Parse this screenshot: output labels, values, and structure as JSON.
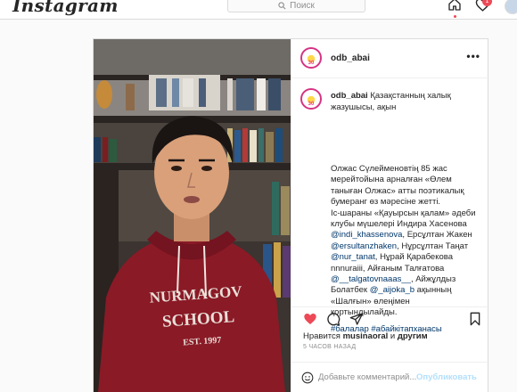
{
  "nav": {
    "logo": "Instagram",
    "search_placeholder": "Поиск",
    "notification_count": "1",
    "icons": [
      "home-icon",
      "activity-heart-icon",
      "profile-avatar"
    ]
  },
  "post": {
    "username": "odb_abai",
    "caption_title": "Қазақстанның халық жазушысы, ақын",
    "caption_lines": [
      "Олжас Сүлейменовтің 85 жас",
      "мерейтойына арналған «Өлем",
      "таныған Олжас» атты поэтикалық",
      "бумеранг өз мәресіне жетті.",
      "Іс-шараны «Қауырсын қалам» әдеби",
      "клубы мүшелері Индира Хасенова"
    ],
    "mention_1": "@indi_khassenova",
    "text_1": ", Ерсұлтан Жакен",
    "mention_2": "@ersultanzhaken",
    "text_2": ", Нұрсұлтан Таңат",
    "mention_3": "@nur_tanat",
    "text_3": ", Нұрай Қарабекова",
    "text_4": "nnnuraiii, Айғаным Талғатова",
    "mention_4": "@__talgatovnaaas__",
    "text_5": ", Айжұлдыз",
    "text_6": "Болатбек ",
    "mention_5": "@_aijoka_b",
    "text_7": " ақынның",
    "text_8": "«Шалғын» өлеңімен",
    "text_9": "қортындылайды.",
    "hashtags": "#балалар #абайкітапханасы",
    "likes_prefix": "Нравится ",
    "likes_user": "musinaoral",
    "likes_mid": " и ",
    "likes_others": "другим",
    "time_ago": "5 ЧАСОВ НАЗАД",
    "comment_placeholder": "Добавьте комментарий...",
    "publish_label": "Опубликовать",
    "liked": true,
    "colors": {
      "like": "#ed4956",
      "link": "#00376b",
      "publish_disabled": "#b2dffc"
    }
  },
  "video": {
    "hoodie_text_1": "NURMAGOV",
    "hoodie_text_2": "SCHOOL",
    "hoodie_text_3": "EST. 1997"
  }
}
